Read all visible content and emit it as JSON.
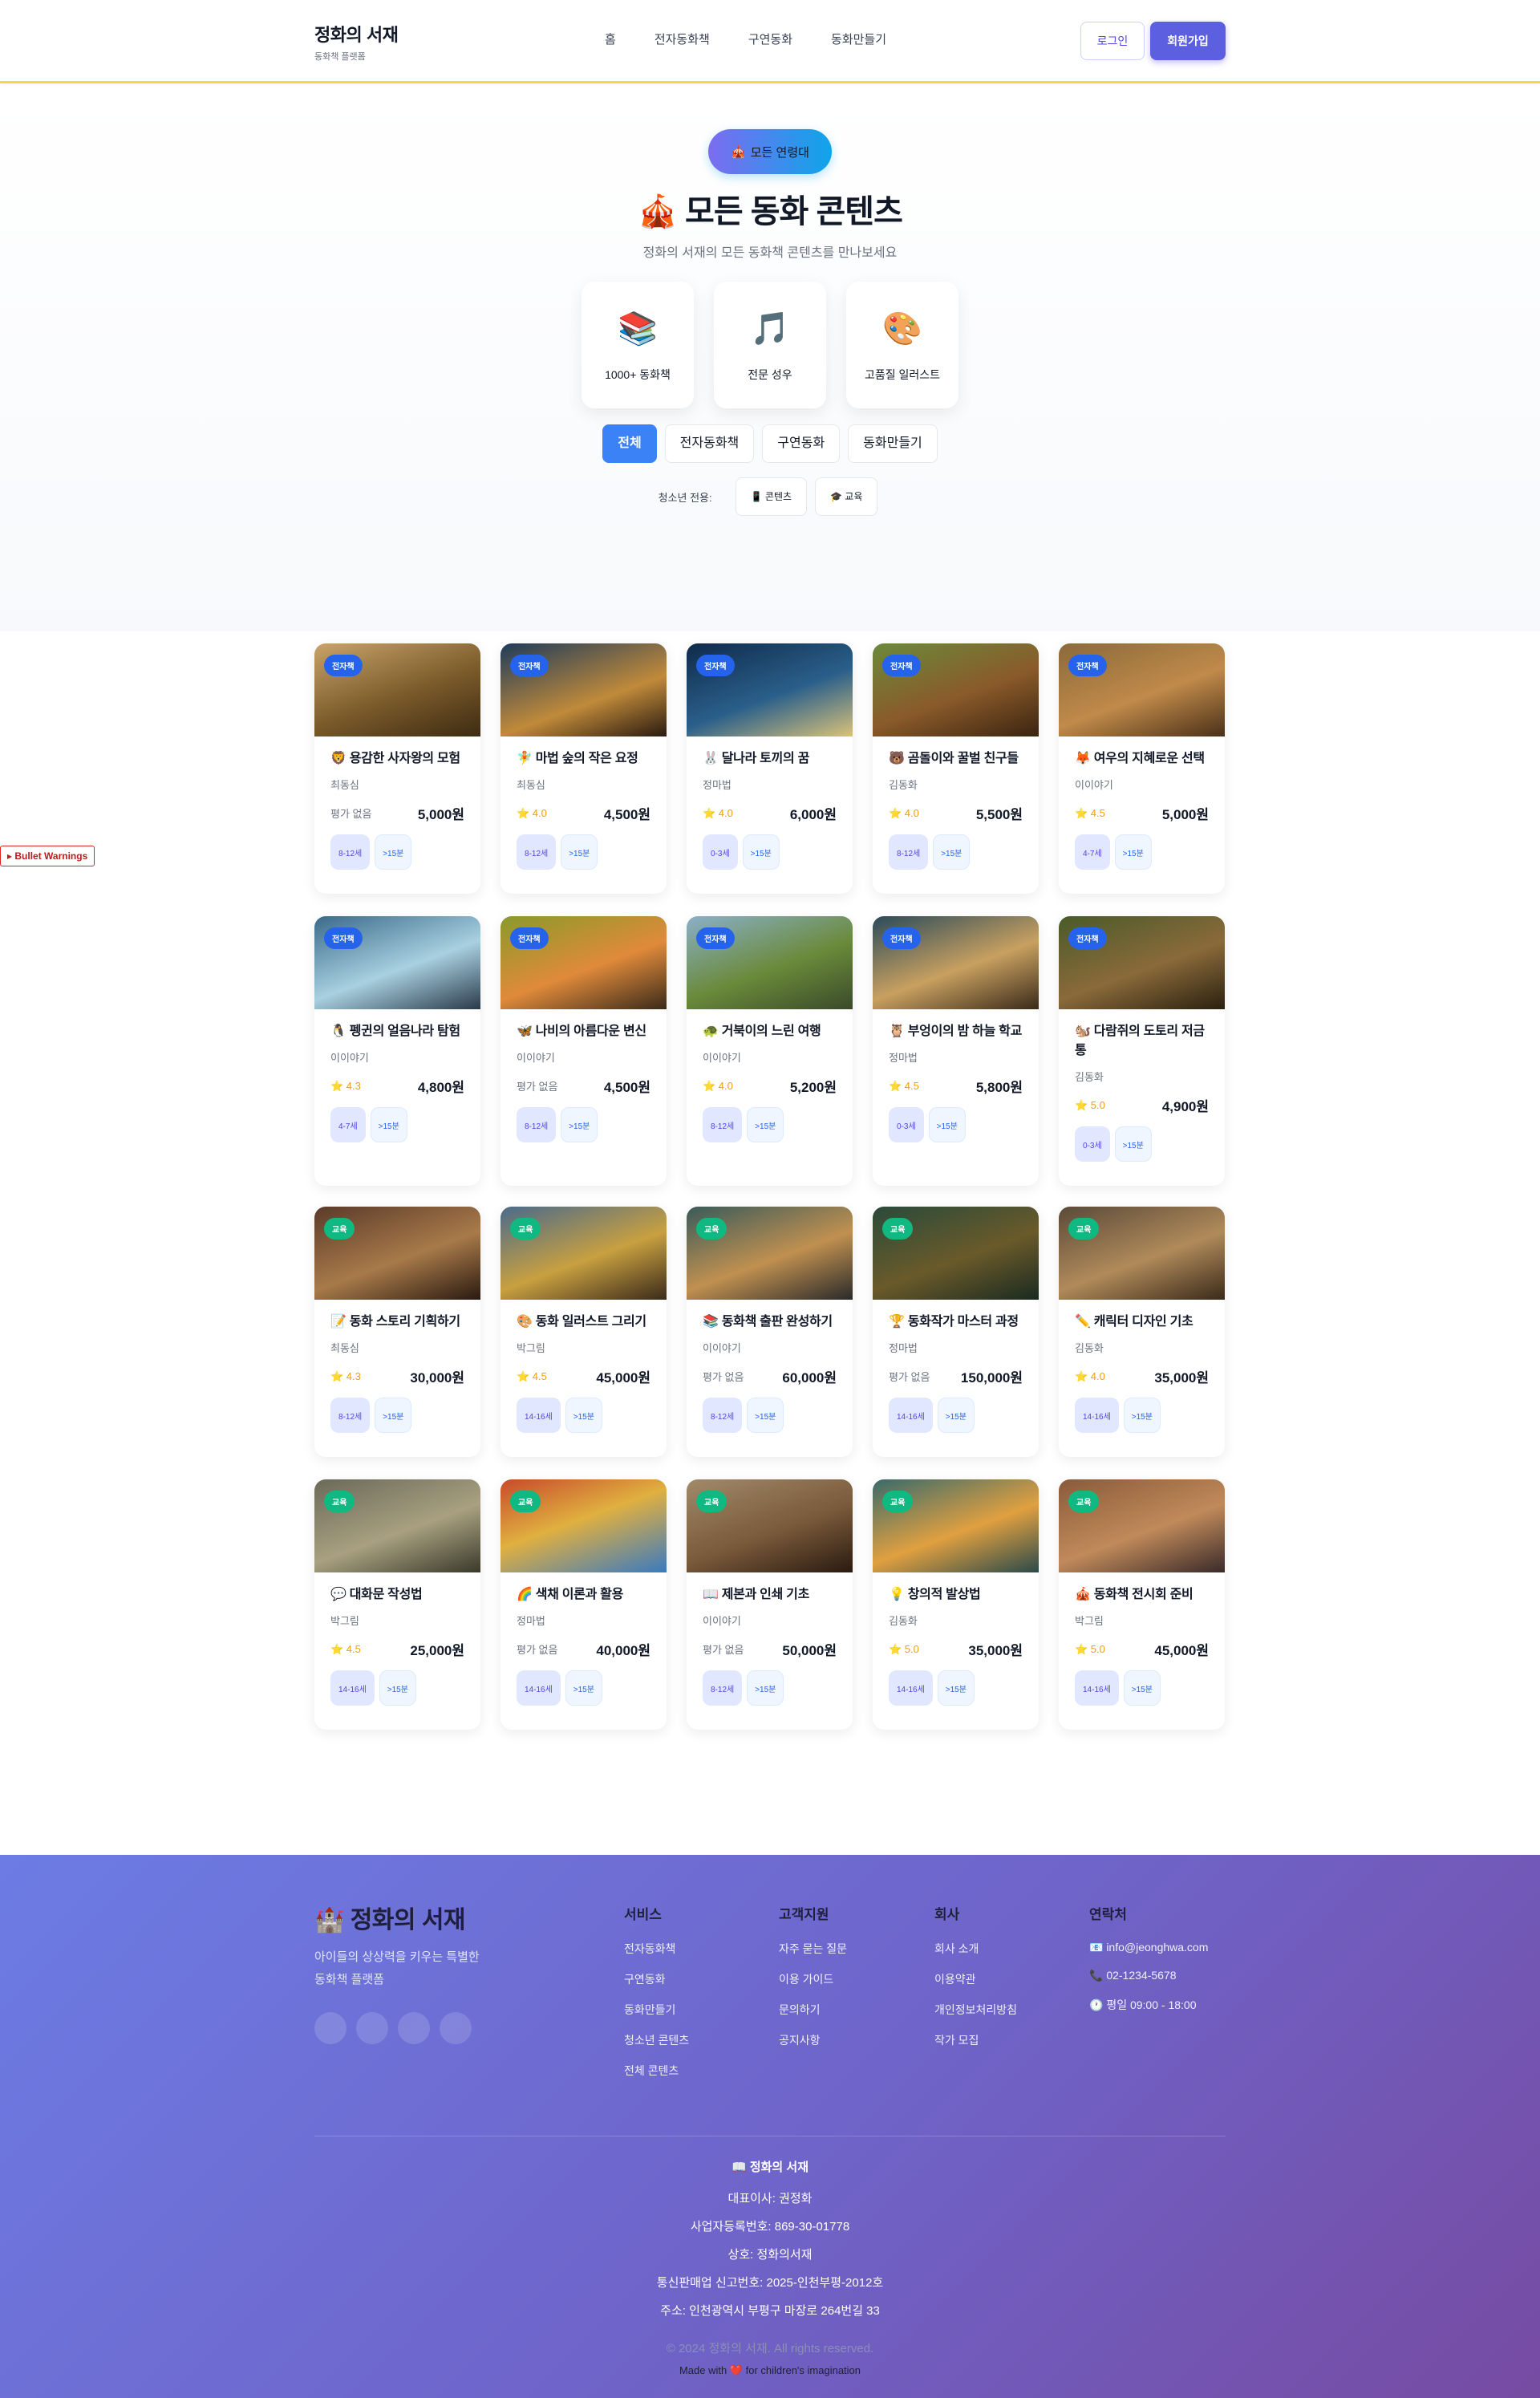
{
  "header": {
    "brand_title": "정화의 서재",
    "brand_sub": "동화책 플랫폼",
    "nav": [
      "홈",
      "전자동화책",
      "구연동화",
      "동화만들기"
    ],
    "login": "로그인",
    "signup": "회원가입"
  },
  "hero": {
    "pill_icon": "🎪",
    "pill": "모든 연령대",
    "title": "🎪 모든 동화 콘텐츠",
    "subtitle": "정화의 서재의 모든 동화책 콘텐츠를 만나보세요",
    "features": [
      {
        "icon": "📚",
        "label": "1000+ 동화책"
      },
      {
        "icon": "🎵",
        "label": "전문 성우"
      },
      {
        "icon": "🎨",
        "label": "고품질 일러스트"
      }
    ],
    "filters": [
      "전체",
      "전자동화책",
      "구연동화",
      "동화만들기"
    ],
    "active_filter": "전체",
    "youth_label": "청소년 전용:",
    "youth_buttons": [
      "📱 콘텐츠",
      "🎓 교육"
    ]
  },
  "side_badge": "▸ Bullet Warnings",
  "products": [
    {
      "badge": "전자책",
      "title": "🦁 용감한 사자왕의 모험",
      "author": "최동심",
      "rating": "평가 없음",
      "price": "5,000원",
      "age": "8-12세",
      "time": ">15분"
    },
    {
      "badge": "전자책",
      "title": "🧚 마법 숲의 작은 요정",
      "author": "최동심",
      "rating": "⭐ 4.0",
      "price": "4,500원",
      "age": "8-12세",
      "time": ">15분"
    },
    {
      "badge": "전자책",
      "title": "🐰 달나라 토끼의 꿈",
      "author": "정마법",
      "rating": "⭐ 4.0",
      "price": "6,000원",
      "age": "0-3세",
      "time": ">15분"
    },
    {
      "badge": "전자책",
      "title": "🐻 곰돌이와 꿀벌 친구들",
      "author": "김동화",
      "rating": "⭐ 4.0",
      "price": "5,500원",
      "age": "8-12세",
      "time": ">15분"
    },
    {
      "badge": "전자책",
      "title": "🦊 여우의 지혜로운 선택",
      "author": "이이야기",
      "rating": "⭐ 4.5",
      "price": "5,000원",
      "age": "4-7세",
      "time": ">15분"
    },
    {
      "badge": "전자책",
      "title": "🐧 펭귄의 얼음나라 탐험",
      "author": "이이야기",
      "rating": "⭐ 4.3",
      "price": "4,800원",
      "age": "4-7세",
      "time": ">15분"
    },
    {
      "badge": "전자책",
      "title": "🦋 나비의 아름다운 변신",
      "author": "이이야기",
      "rating": "평가 없음",
      "price": "4,500원",
      "age": "8-12세",
      "time": ">15분"
    },
    {
      "badge": "전자책",
      "title": "🐢 거북이의 느린 여행",
      "author": "이이야기",
      "rating": "⭐ 4.0",
      "price": "5,200원",
      "age": "8-12세",
      "time": ">15분"
    },
    {
      "badge": "전자책",
      "title": "🦉 부엉이의 밤 하늘 학교",
      "author": "정마법",
      "rating": "⭐ 4.5",
      "price": "5,800원",
      "age": "0-3세",
      "time": ">15분"
    },
    {
      "badge": "전자책",
      "title": "🐿️ 다람쥐의 도토리 저금통",
      "author": "김동화",
      "rating": "⭐ 5.0",
      "price": "4,900원",
      "age": "0-3세",
      "time": ">15분"
    },
    {
      "badge": "교육",
      "title": "📝 동화 스토리 기획하기",
      "author": "최동심",
      "rating": "⭐ 4.3",
      "price": "30,000원",
      "age": "8-12세",
      "time": ">15분"
    },
    {
      "badge": "교육",
      "title": "🎨 동화 일러스트 그리기",
      "author": "박그림",
      "rating": "⭐ 4.5",
      "price": "45,000원",
      "age": "14-16세",
      "time": ">15분"
    },
    {
      "badge": "교육",
      "title": "📚 동화책 출판 완성하기",
      "author": "이이야기",
      "rating": "평가 없음",
      "price": "60,000원",
      "age": "8-12세",
      "time": ">15분"
    },
    {
      "badge": "교육",
      "title": "🏆 동화작가 마스터 과정",
      "author": "정마법",
      "rating": "평가 없음",
      "price": "150,000원",
      "age": "14-16세",
      "time": ">15분"
    },
    {
      "badge": "교육",
      "title": "✏️ 캐릭터 디자인 기초",
      "author": "김동화",
      "rating": "⭐ 4.0",
      "price": "35,000원",
      "age": "14-16세",
      "time": ">15분"
    },
    {
      "badge": "교육",
      "title": "💬 대화문 작성법",
      "author": "박그림",
      "rating": "⭐ 4.5",
      "price": "25,000원",
      "age": "14-16세",
      "time": ">15분"
    },
    {
      "badge": "교육",
      "title": "🌈 색채 이론과 활용",
      "author": "정마법",
      "rating": "평가 없음",
      "price": "40,000원",
      "age": "14-16세",
      "time": ">15분"
    },
    {
      "badge": "교육",
      "title": "📖 제본과 인쇄 기초",
      "author": "이이야기",
      "rating": "평가 없음",
      "price": "50,000원",
      "age": "8-12세",
      "time": ">15분"
    },
    {
      "badge": "교육",
      "title": "💡 창의적 발상법",
      "author": "김동화",
      "rating": "⭐ 5.0",
      "price": "35,000원",
      "age": "14-16세",
      "time": ">15분"
    },
    {
      "badge": "교육",
      "title": "🎪 동화책 전시회 준비",
      "author": "박그림",
      "rating": "⭐ 5.0",
      "price": "45,000원",
      "age": "14-16세",
      "time": ">15분"
    }
  ],
  "footer": {
    "brand": "🏰 정화의 서재",
    "desc": "아이들의 상상력을 키우는 특별한 동화책 플랫폼",
    "columns": [
      {
        "title": "서비스",
        "links": [
          "전자동화책",
          "구연동화",
          "동화만들기",
          "청소년 콘텐츠",
          "전체 콘텐츠"
        ]
      },
      {
        "title": "고객지원",
        "links": [
          "자주 묻는 질문",
          "이용 가이드",
          "문의하기",
          "공지사항"
        ]
      },
      {
        "title": "회사",
        "links": [
          "회사 소개",
          "이용약관",
          "개인정보처리방침",
          "작가 모집"
        ]
      },
      {
        "title": "연락처",
        "links": [
          "📧 info@jeonghwa.com",
          "📞 02-1234-5678",
          "🕐 평일 09:00 - 18:00"
        ]
      }
    ],
    "bottom_name": "📖 정화의 서재",
    "bottom_lines": [
      "대표이사: 권정화",
      "사업자등록번호: 869-30-01778",
      "상호: 정화의서재",
      "통신판매업 신고번호: 2025-인천부평-2012호",
      "주소: 인천광역시 부평구 마장로 264번길 33"
    ],
    "copyright": "© 2024 정화의 서재. All rights reserved.",
    "made_with": "Made with ❤️ for children's imagination"
  }
}
